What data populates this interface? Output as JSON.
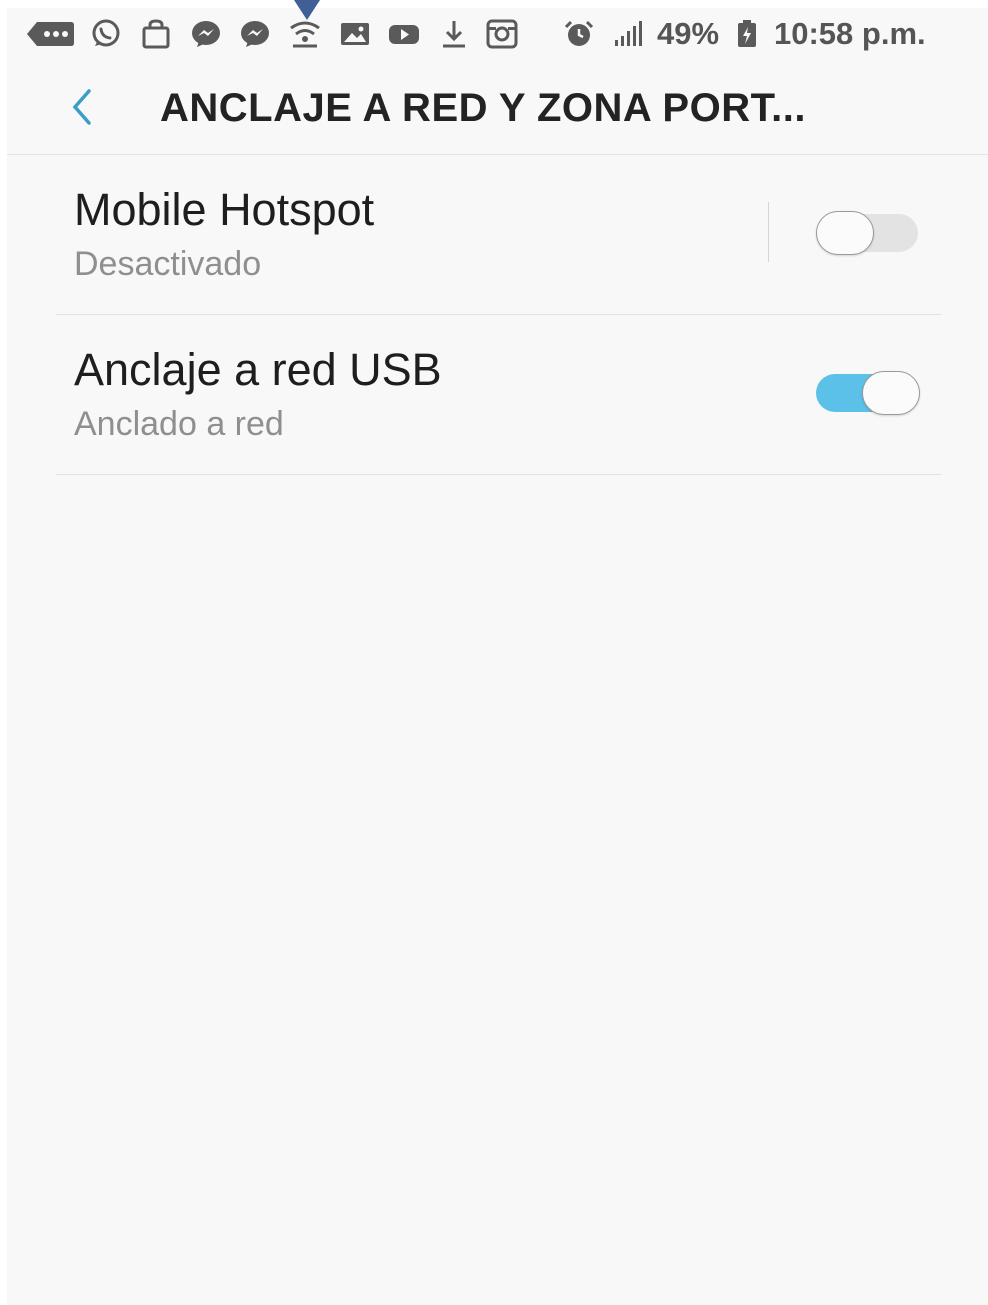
{
  "status_bar": {
    "icons": [
      "message-bubble-icon",
      "whatsapp-icon",
      "shopping-bag-icon",
      "messenger-icon",
      "messenger-icon",
      "hotspot-icon",
      "gallery-icon",
      "youtube-icon",
      "download-icon",
      "instagram-icon",
      "alarm-icon",
      "signal-icon"
    ],
    "battery_percent": "49%",
    "time": "10:58 p.m."
  },
  "header": {
    "title": "ANCLAJE A RED Y ZONA PORT..."
  },
  "settings": [
    {
      "title": "Mobile Hotspot",
      "subtitle": "Desactivado",
      "enabled": false
    },
    {
      "title": "Anclaje a red USB",
      "subtitle": "Anclado a red",
      "enabled": true
    }
  ],
  "colors": {
    "accent": "#5cc1e8",
    "background": "#f8f8f8",
    "marker": "#3f5f96"
  }
}
